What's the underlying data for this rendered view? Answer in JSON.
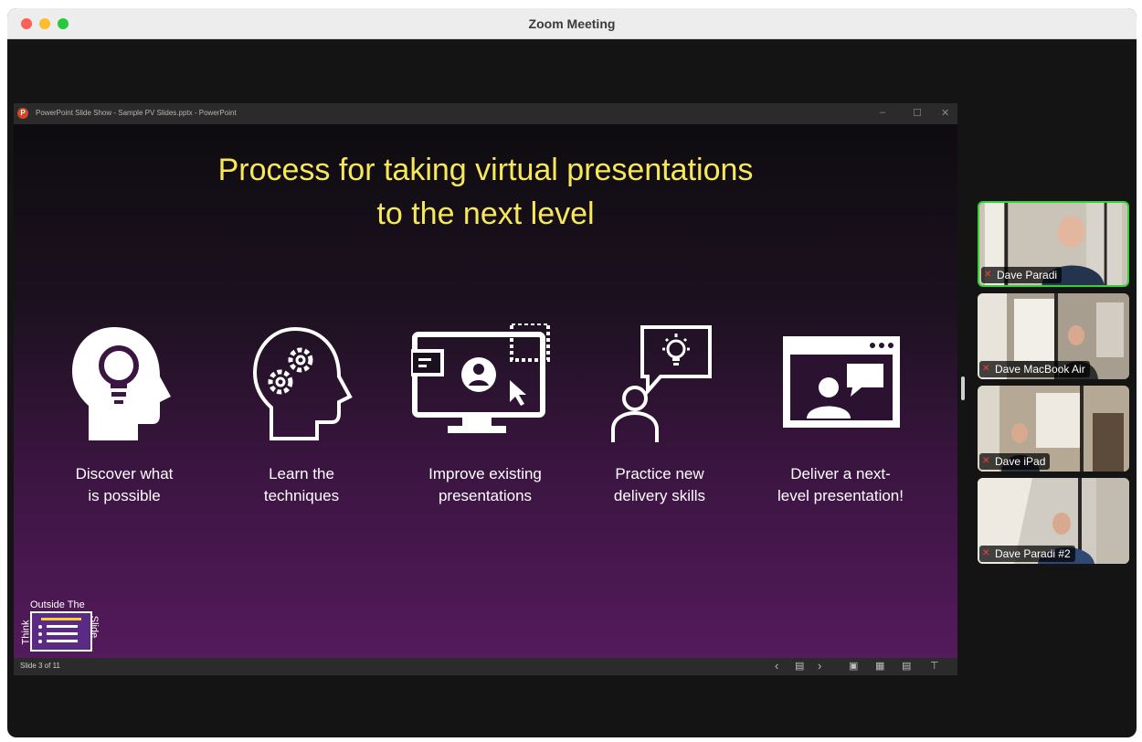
{
  "window": {
    "title": "Zoom Meeting"
  },
  "powerpoint": {
    "app_letter": "P",
    "caption": "PowerPoint Slide Show  -  Sample PV Slides.pptx  -  PowerPoint",
    "controls": {
      "minimize": "–",
      "maximize": "☐",
      "close": "✕"
    },
    "slide": {
      "title_line1": "Process for taking virtual presentations",
      "title_line2": "to the next level",
      "steps": [
        {
          "line1": "Discover what",
          "line2": "is possible",
          "icon": "head-lightbulb-icon"
        },
        {
          "line1": "Learn the",
          "line2": "techniques",
          "icon": "head-gears-icon"
        },
        {
          "line1": "Improve existing",
          "line2": "presentations",
          "icon": "monitor-presentation-icon"
        },
        {
          "line1": "Practice new",
          "line2": "delivery skills",
          "icon": "person-idea-bubble-icon"
        },
        {
          "line1": "Deliver a next-",
          "line2": "level presentation!",
          "icon": "video-call-window-icon"
        }
      ],
      "logo": {
        "top_text": "Outside The",
        "left_text": "Think",
        "right_text": "Slide",
        "trademark": "™"
      },
      "colors": {
        "title": "#f7e858",
        "background_top": "#0e0c10",
        "background_bottom": "#541a5c"
      }
    },
    "status": {
      "slide_counter": "Slide 3 of 11",
      "prev": "‹",
      "notes": "▤",
      "next": "›",
      "view_normal": "▣",
      "view_sorter": "▦",
      "view_reading": "▤",
      "view_show": "⊤"
    }
  },
  "participants": [
    {
      "name": "Dave Paradi",
      "muted": true,
      "active_speaker": true
    },
    {
      "name": "Dave MacBook Air",
      "muted": true,
      "active_speaker": false
    },
    {
      "name": "Dave iPad",
      "muted": true,
      "active_speaker": false
    },
    {
      "name": "Dave Paradi #2",
      "muted": true,
      "active_speaker": false
    }
  ],
  "accent_colors": {
    "active_speaker_border": "#35d233",
    "mute_icon": "#ff3b30"
  }
}
